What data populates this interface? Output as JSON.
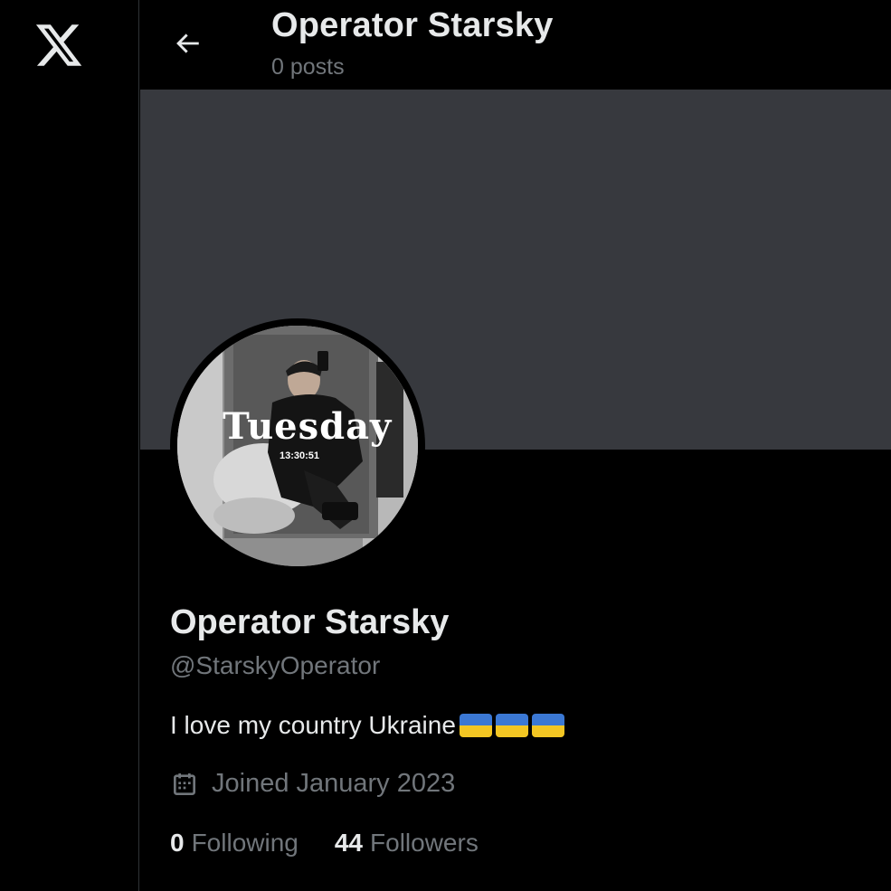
{
  "header": {
    "title": "Operator Starsky",
    "post_count": "0 posts"
  },
  "profile": {
    "display_name": "Operator Starsky",
    "handle": "@StarskyOperator",
    "bio_text": "I love my country Ukraine",
    "bio_emoji_count": 3,
    "joined": "Joined January 2023",
    "avatar_overlay_title": "Tuesday",
    "avatar_overlay_time": "13:30:51"
  },
  "stats": {
    "following_count": "0",
    "following_label": "Following",
    "followers_count": "44",
    "followers_label": "Followers"
  },
  "icons": {
    "logo": "x-logo-icon",
    "back": "arrow-left-icon",
    "calendar": "calendar-icon",
    "flag": "ukraine-flag-icon"
  },
  "colors": {
    "background": "#000000",
    "banner": "#37393e",
    "text_primary": "#e7e9ea",
    "text_secondary": "#71767b",
    "flag_blue": "#3b78d4",
    "flag_yellow": "#f3c623"
  }
}
